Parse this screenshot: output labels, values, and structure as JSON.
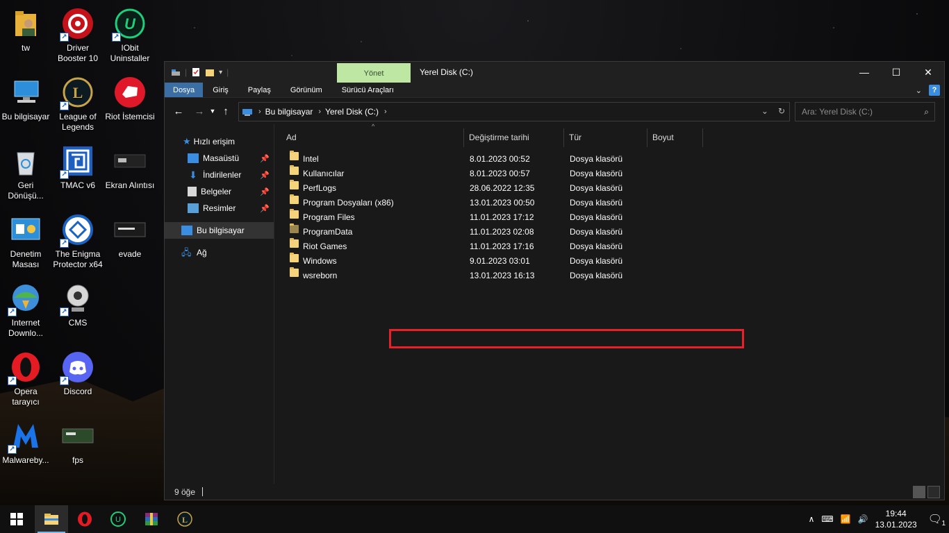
{
  "desktop": {
    "icons": [
      {
        "label": "tw",
        "icon": "user-folder-icon"
      },
      {
        "label": "Driver Booster 10",
        "icon": "driver-booster-icon"
      },
      {
        "label": "IObit Uninstaller",
        "icon": "iobit-uninstaller-icon"
      },
      {
        "label": "Bu bilgisayar",
        "icon": "this-pc-icon"
      },
      {
        "label": "League of Legends",
        "icon": "league-of-legends-icon"
      },
      {
        "label": "Riot İstemcisi",
        "icon": "riot-client-icon"
      },
      {
        "label": "Geri Dönüşü...",
        "icon": "recycle-bin-icon"
      },
      {
        "label": "TMAC v6",
        "icon": "tmac-icon"
      },
      {
        "label": "Ekran Alıntısı",
        "icon": "screenshot-icon"
      },
      {
        "label": "Denetim Masası",
        "icon": "control-panel-icon"
      },
      {
        "label": "The Enigma Protector x64",
        "icon": "enigma-protector-icon"
      },
      {
        "label": "evade",
        "icon": "evade-icon"
      },
      {
        "label": "Internet Downlo...",
        "icon": "internet-download-manager-icon"
      },
      {
        "label": "CMS",
        "icon": "webcam-icon"
      },
      {
        "label": "Opera tarayıcı",
        "icon": "opera-icon"
      },
      {
        "label": "Discord",
        "icon": "discord-icon"
      },
      {
        "label": "Malwareby...",
        "icon": "malwarebytes-icon"
      },
      {
        "label": "fps",
        "icon": "fps-icon"
      }
    ]
  },
  "window": {
    "title": "Yerel Disk (C:)",
    "manage_tab": "Yönet",
    "ribbon_tabs": [
      "Dosya",
      "Giriş",
      "Paylaş",
      "Görünüm",
      "Sürücü Araçları"
    ],
    "breadcrumb": [
      "Bu bilgisayar",
      "Yerel Disk (C:)"
    ],
    "search_placeholder": "Ara: Yerel Disk (C:)",
    "nav": {
      "quick_access": "Hızlı erişim",
      "items": [
        "Masaüstü",
        "İndirilenler",
        "Belgeler",
        "Resimler"
      ],
      "this_pc": "Bu bilgisayar",
      "network": "Ağ"
    },
    "columns": [
      "Ad",
      "Değiştirme tarihi",
      "Tür",
      "Boyut"
    ],
    "files": [
      {
        "name": "Intel",
        "date": "8.01.2023 00:52",
        "type": "Dosya klasörü"
      },
      {
        "name": "Kullanıcılar",
        "date": "8.01.2023 00:57",
        "type": "Dosya klasörü"
      },
      {
        "name": "PerfLogs",
        "date": "28.06.2022 12:35",
        "type": "Dosya klasörü"
      },
      {
        "name": "Program Dosyaları (x86)",
        "date": "13.01.2023 00:50",
        "type": "Dosya klasörü"
      },
      {
        "name": "Program Files",
        "date": "11.01.2023 17:12",
        "type": "Dosya klasörü"
      },
      {
        "name": "ProgramData",
        "date": "11.01.2023 02:08",
        "type": "Dosya klasörü"
      },
      {
        "name": "Riot Games",
        "date": "11.01.2023 17:16",
        "type": "Dosya klasörü"
      },
      {
        "name": "Windows",
        "date": "9.01.2023 03:01",
        "type": "Dosya klasörü"
      },
      {
        "name": "wsreborn",
        "date": "13.01.2023 16:13",
        "type": "Dosya klasörü"
      }
    ],
    "status": "9 öğe"
  },
  "taskbar": {
    "time": "19:44",
    "date": "13.01.2023",
    "notification_count": "1"
  }
}
